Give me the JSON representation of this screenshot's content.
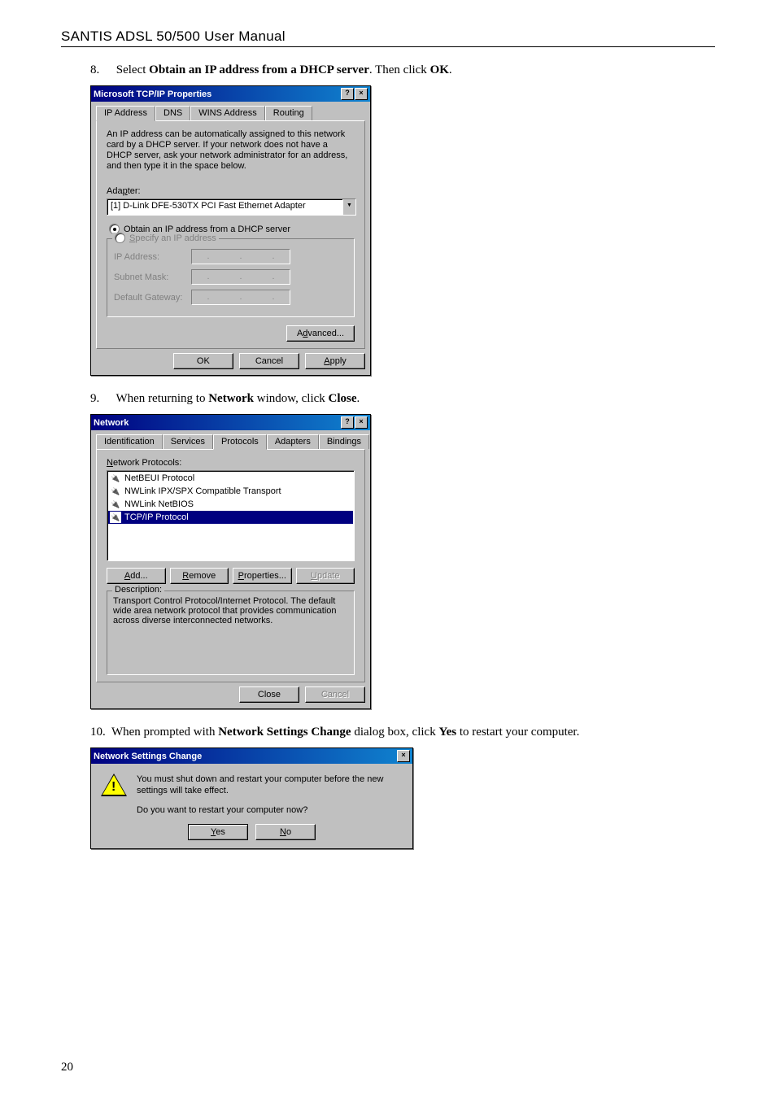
{
  "header": "SANTIS ADSL 50/500 User Manual",
  "step8": {
    "num": "8.",
    "pre": "Select ",
    "b1": "Obtain an IP address from a DHCP server",
    "mid": ". Then click ",
    "b2": "OK",
    "post": "."
  },
  "step9": {
    "num": "9.",
    "pre": "When returning to ",
    "b1": "Network",
    "mid": " window, click ",
    "b2": "Close",
    "post": "."
  },
  "step10": {
    "num": "10.",
    "pre": "When prompted with ",
    "b1": "Network Settings Change",
    "mid": " dialog box, click ",
    "b2": "Yes",
    "post": " to restart your computer."
  },
  "dlg1": {
    "title": "Microsoft TCP/IP Properties",
    "tabs": [
      "IP Address",
      "DNS",
      "WINS Address",
      "Routing"
    ],
    "info": "An IP address can be automatically assigned to this network card by a DHCP server. If your network does not have a DHCP server, ask your network administrator for an address, and then type it in the space below.",
    "adapter_label": "Adapter:",
    "adapter_value": "[1] D-Link DFE-530TX PCI Fast Ethernet Adapter",
    "radio1": "Obtain an IP address from a DHCP server",
    "radio2": "Specify an IP address",
    "ip_label": "IP Address:",
    "subnet_label": "Subnet Mask:",
    "gateway_label": "Default Gateway:",
    "advanced": "Advanced...",
    "ok": "OK",
    "cancel": "Cancel",
    "apply": "Apply"
  },
  "dlg2": {
    "title": "Network",
    "tabs": [
      "Identification",
      "Services",
      "Protocols",
      "Adapters",
      "Bindings"
    ],
    "list_label": "Network Protocols:",
    "items": [
      "NetBEUI Protocol",
      "NWLink IPX/SPX Compatible Transport",
      "NWLink NetBIOS",
      "TCP/IP Protocol"
    ],
    "add": "Add...",
    "remove": "Remove",
    "properties": "Properties...",
    "update": "Update",
    "desc_title": "Description:",
    "desc": "Transport Control Protocol/Internet Protocol. The default wide area network protocol that provides communication across diverse interconnected networks.",
    "close": "Close",
    "cancel": "Cancel"
  },
  "dlg3": {
    "title": "Network Settings Change",
    "msg1": "You must shut down and restart your computer before the new settings will take effect.",
    "msg2": "Do you want to restart your computer now?",
    "yes": "Yes",
    "no": "No"
  },
  "pagenum": "20"
}
